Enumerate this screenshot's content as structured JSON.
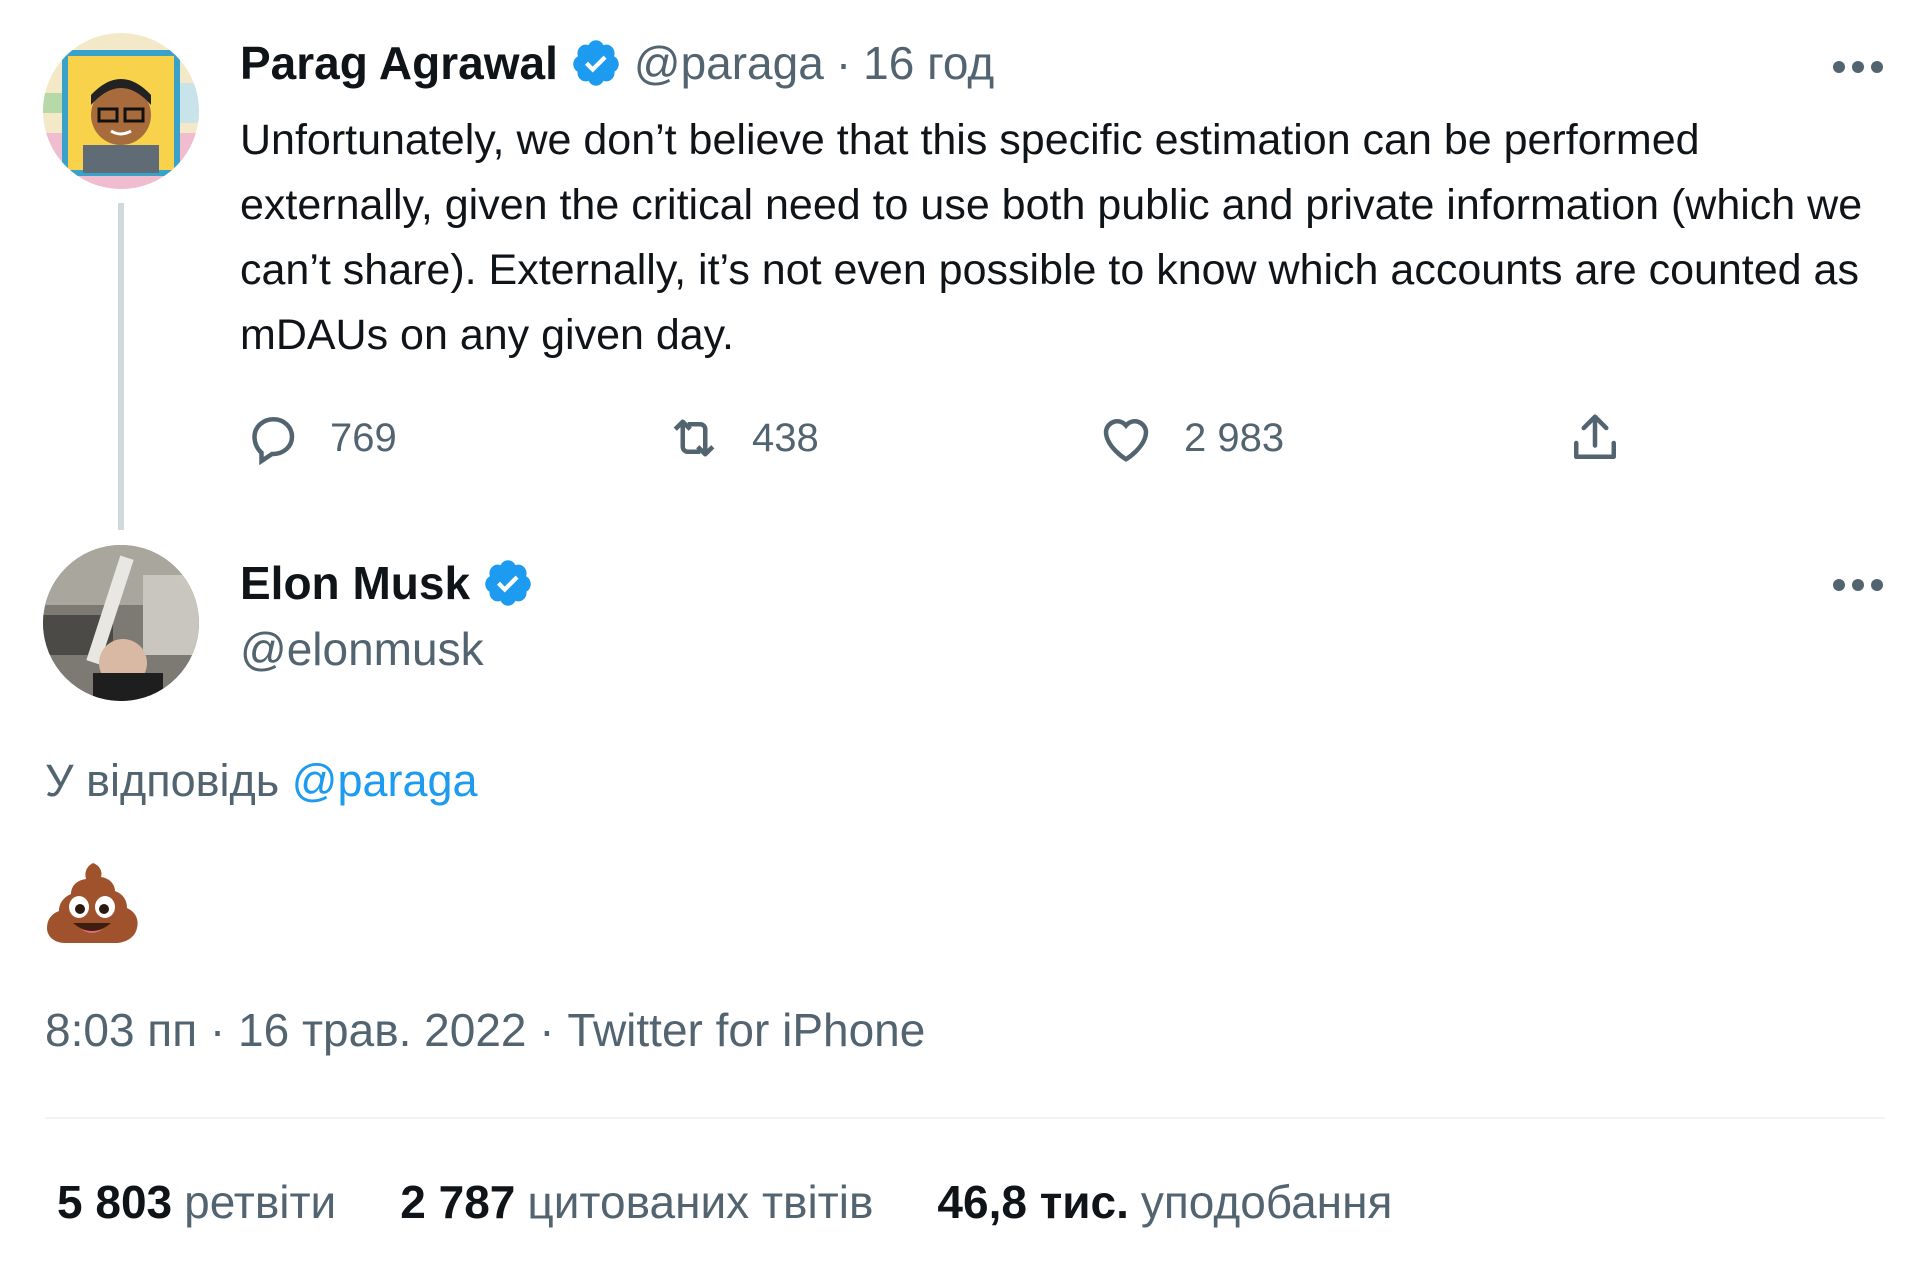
{
  "parent_tweet": {
    "author_name": "Parag Agrawal",
    "handle": "@paraga",
    "separator": "·",
    "time_ago": "16 год",
    "text": "Unfortunately, we don’t believe that this specific estimation can be performed externally, given the critical need to use both public and private information (which we can’t share). Externally, it’s not even possible to know which accounts are counted as mDAUs on any given day.",
    "actions": {
      "replies": "769",
      "retweets": "438",
      "likes": "2 983"
    }
  },
  "main_tweet": {
    "author_name": "Elon Musk",
    "handle": "@elonmusk",
    "reply_prefix": "У відповідь",
    "reply_mention": "@paraga",
    "content_emoji": "pile-of-poo",
    "timestamp": "8:03 пп · 16 трав. 2022 · Twitter for iPhone",
    "stats": [
      {
        "count": "5 803",
        "label": "ретвіти"
      },
      {
        "count": "2 787",
        "label": "цитованих твітів"
      },
      {
        "count": "46,8 тис.",
        "label": "уподобання"
      }
    ]
  },
  "colors": {
    "verified": "#1d9bf0",
    "link": "#1d9bf0",
    "secondary_text": "#536471",
    "thread_line": "#cfd9de"
  }
}
